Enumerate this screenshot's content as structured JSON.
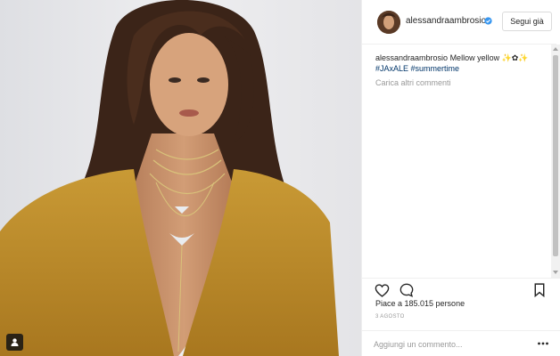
{
  "post": {
    "author": {
      "username": "alessandraambrosio",
      "verified": true,
      "follow_label": "Segui già"
    },
    "caption": {
      "username": "alessandraambrosio",
      "text": "Mellow yellow ✨✿✨",
      "hashtags": [
        "#JAxALE",
        "#summertime"
      ]
    },
    "load_more_comments": "Carica altri commenti",
    "likes_text": "Piace a 185.015 persone",
    "date": "3 AGOSTO",
    "comment_placeholder": "Aggiungi un commento...",
    "photo": {
      "subject": "woman with long wavy brown hair, mustard-yellow cardigan, layered gold necklaces"
    }
  },
  "icons": [
    "user-tag-icon",
    "verified-badge-icon",
    "heart-icon",
    "comment-icon",
    "bookmark-icon",
    "more-options-icon"
  ],
  "colors": {
    "text_primary": "#262626",
    "text_secondary": "#999999",
    "hashtag": "#003569",
    "border": "#efefef",
    "verified": "#3897f0",
    "cardigan": "#b98a2b"
  }
}
